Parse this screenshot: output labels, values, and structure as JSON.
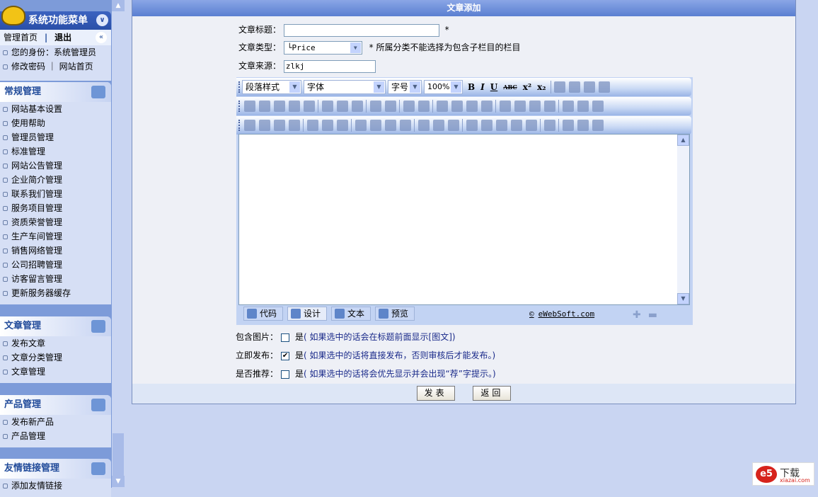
{
  "sidebar": {
    "title": "系统功能菜单",
    "top_links": {
      "home": "管理首页",
      "sep": "|",
      "logout": "退出"
    },
    "info": [
      "您的身份：系统管理员",
      "修改密码 ｜ 网站首页"
    ],
    "groups": [
      {
        "title": "常规管理",
        "items": [
          "网站基本设置",
          "使用帮助",
          "管理员管理",
          "标准管理",
          "网站公告管理",
          "企业简介管理",
          "联系我们管理",
          "服务项目管理",
          "资质荣誉管理",
          "生产车间管理",
          "销售网络管理",
          "公司招聘管理",
          "访客留言管理",
          "更新服务器缓存"
        ]
      },
      {
        "title": "文章管理",
        "items": [
          "发布文章",
          "文章分类管理",
          "文章管理"
        ]
      },
      {
        "title": "产品管理",
        "items": [
          "发布新产品",
          "产品管理"
        ]
      },
      {
        "title": "友情链接管理",
        "items": [
          "添加友情链接"
        ]
      }
    ]
  },
  "form": {
    "title": "文章添加",
    "title_label": "文章标题：",
    "title_value": "",
    "required": "*",
    "type_label": "文章类型：",
    "type_value": "└Price",
    "type_note": "* 所属分类不能选择为包含子栏目的栏目",
    "source_label": "文章来源：",
    "source_value": "zlkj"
  },
  "editor": {
    "selects": [
      "段落样式",
      "字体",
      "字号",
      "100%"
    ],
    "format": [
      "B",
      "I",
      "U",
      "ABC",
      "x²",
      "x₂"
    ],
    "modes": [
      "代码",
      "设计",
      "文本",
      "预览"
    ],
    "active_mode": "设计",
    "credit": "eWebSoft.com",
    "credit_symbol": "©"
  },
  "options": [
    {
      "label": "包含图片：",
      "checked": false,
      "yes": "是",
      "hint": "( 如果选中的话会在标题前面显示[图文])"
    },
    {
      "label": "立即发布：",
      "checked": true,
      "yes": "是",
      "hint": "( 如果选中的话将直接发布，否则审核后才能发布。)"
    },
    {
      "label": "是否推荐：",
      "checked": false,
      "yes": "是",
      "hint": "( 如果选中的话将会优先显示并会出现“荐”字提示。)"
    }
  ],
  "buttons": {
    "submit": "发表",
    "back": "返回"
  },
  "watermark": {
    "logo": "e5",
    "text": "下载",
    "site": "xiazai.com"
  }
}
